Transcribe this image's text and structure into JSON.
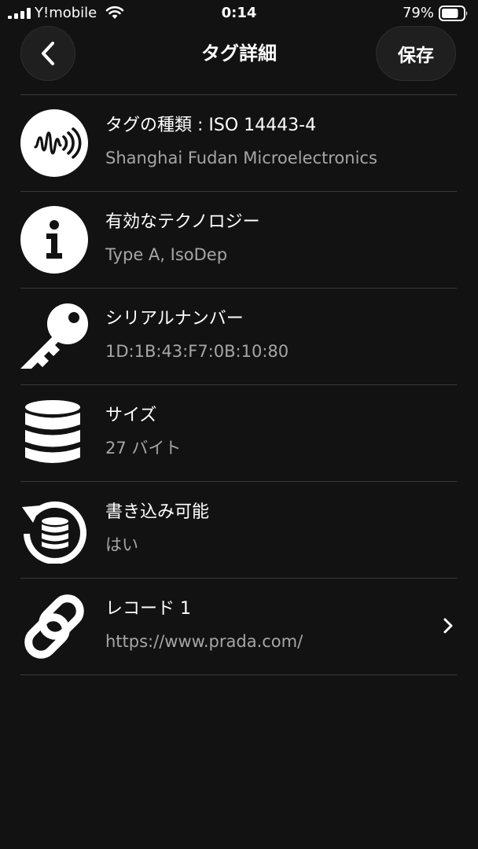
{
  "status_bar": {
    "carrier": "Y!mobile",
    "time": "0:14",
    "battery_percent": "79%",
    "battery_level": 0.79,
    "icons": [
      "cellular-signal-icon",
      "wifi-icon",
      "battery-icon"
    ]
  },
  "nav": {
    "title": "タグ詳細",
    "save_label": "保存",
    "back_icon": "chevron-left-icon"
  },
  "rows": [
    {
      "icon": "nfc-waveform-icon",
      "title": "タグの種類 : ISO 14443-4",
      "value": "Shanghai Fudan Microelectronics"
    },
    {
      "icon": "info-icon",
      "title": "有効なテクノロジー",
      "value": "Type A, IsoDep"
    },
    {
      "icon": "key-icon",
      "title": "シリアルナンバー",
      "value": "1D:1B:43:F7:0B:10:80"
    },
    {
      "icon": "database-icon",
      "title": "サイズ",
      "value": "27 バイト"
    },
    {
      "icon": "rewrite-database-icon",
      "title": "書き込み可能",
      "value": "はい"
    },
    {
      "icon": "link-icon",
      "title": "レコード 1",
      "value": "https://www.prada.com/",
      "chevron": "chevron-right-icon"
    }
  ],
  "colors": {
    "background": "#121212",
    "text_primary": "#ffffff",
    "text_secondary": "#a6a6a6",
    "separator": "#3a3a3a",
    "button_bg": "#1f1f1f"
  }
}
